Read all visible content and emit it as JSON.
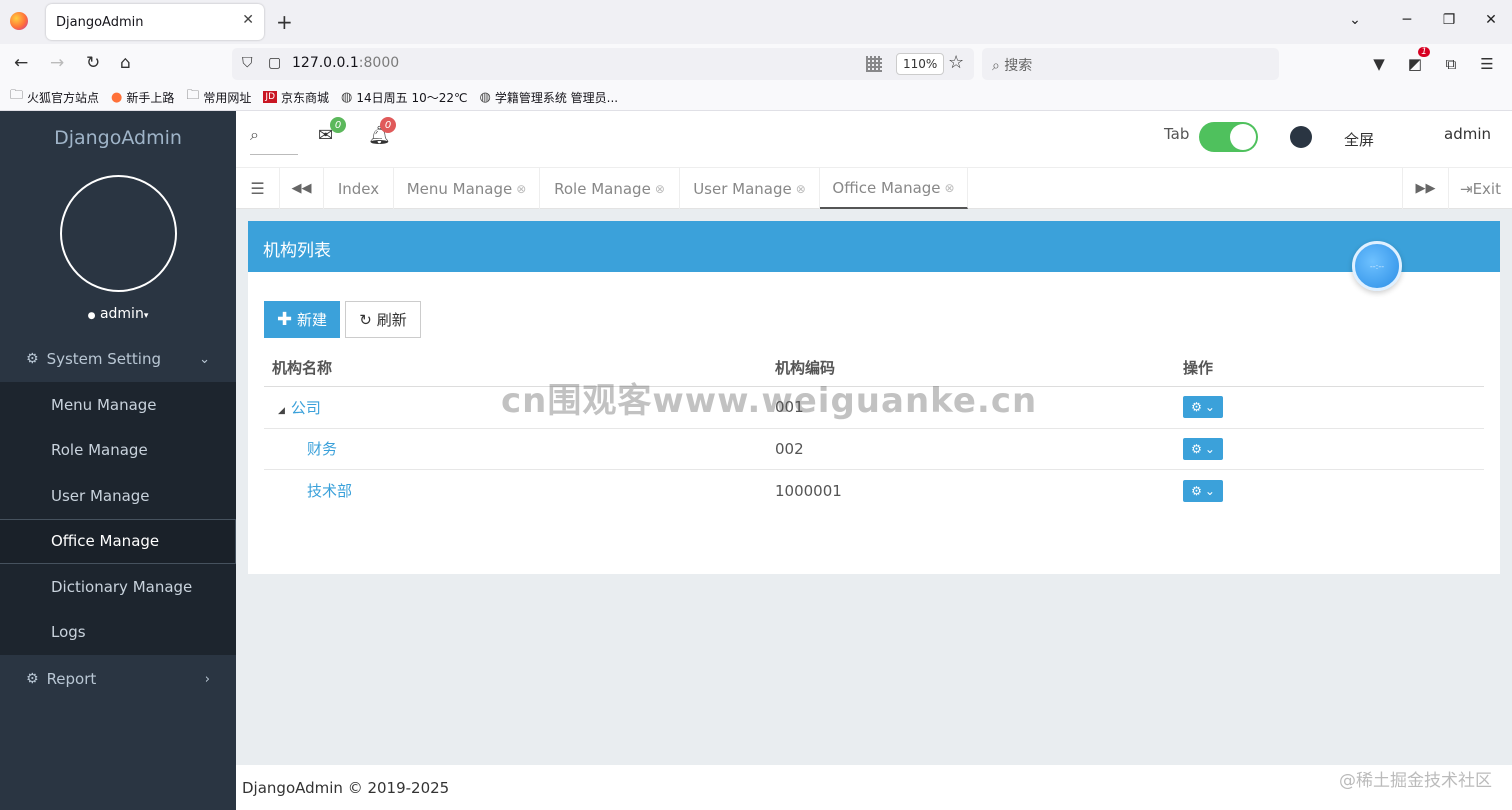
{
  "browser": {
    "tab_title": "DjangoAdmin",
    "close_glyph": "✕",
    "new_tab_glyph": "+",
    "url_host": "127.0.0.1",
    "url_port": ":8000",
    "zoom": "110%",
    "search_placeholder": "搜索",
    "ext_badge": "1",
    "bookmarks": [
      {
        "label": "火狐官方站点",
        "icon": "folder-icon"
      },
      {
        "label": "新手上路",
        "icon": "firefox-icon"
      },
      {
        "label": "常用网址",
        "icon": "folder-icon"
      },
      {
        "label": "京东商城",
        "icon": "jd-icon"
      },
      {
        "label": "14日周五   10～22℃",
        "icon": "globe-icon"
      },
      {
        "label": "学籍管理系统 管理员...",
        "icon": "globe-icon"
      }
    ]
  },
  "sidebar": {
    "logo": "DjangoAdmin",
    "username": "admin",
    "groups": {
      "system": "System Setting",
      "report": "Report"
    },
    "items": [
      "Menu Manage",
      "Role Manage",
      "User Manage",
      "Office Manage",
      "Dictionary Manage",
      "Logs"
    ],
    "active_item": "Office Manage"
  },
  "topbar": {
    "mail_count": "0",
    "bell_count": "0",
    "tab_label": "Tab",
    "fullscreen": "全屏",
    "user": "admin",
    "colors": {
      "mail_badge": "#5cb85c",
      "bell_badge": "#e05a5a",
      "toggle_on": "#4fc15d"
    }
  },
  "tabs": {
    "items": [
      "Index",
      "Menu Manage",
      "Role Manage",
      "User Manage",
      "Office Manage"
    ],
    "active": "Office Manage",
    "exit": "Exit"
  },
  "panel": {
    "title": "机构列表",
    "clock": "--:--",
    "new_btn": "新建",
    "refresh_btn": "刷新",
    "columns": [
      "机构名称",
      "机构编码",
      "操作"
    ],
    "rows": [
      {
        "name": "公司",
        "code": "001",
        "level": 0
      },
      {
        "name": "财务",
        "code": "002",
        "level": 1
      },
      {
        "name": "技术部",
        "code": "1000001",
        "level": 1
      }
    ]
  },
  "watermark": "cn围观客www.weiguanke.cn",
  "footer": "DjangoAdmin © 2019-2025",
  "corner_watermark": "@稀土掘金技术社区",
  "colors": {
    "sidebar_bg": "#2a3542",
    "accent": "#3ba1da"
  }
}
